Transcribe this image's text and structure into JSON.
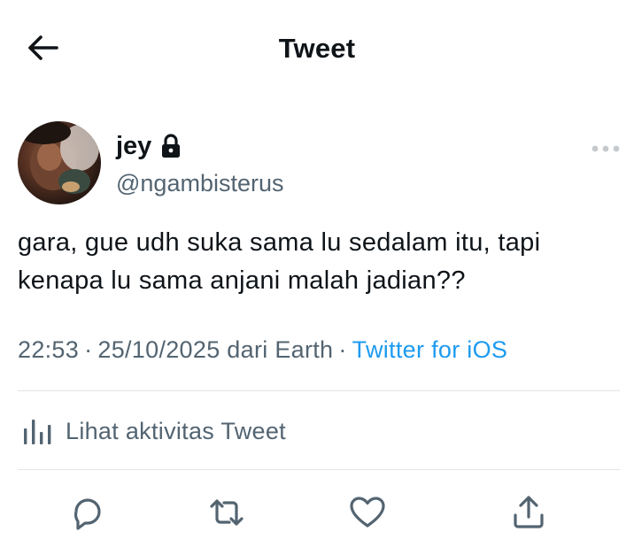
{
  "header": {
    "title": "Tweet",
    "back_icon": "arrow-left-icon"
  },
  "author": {
    "display_name": "jey",
    "handle": "@ngambisterus",
    "protected_icon": "lock-icon"
  },
  "tweet": {
    "text_line_1": "gara, gue udh suka sama lu sedalam itu, tapi",
    "text_line_2": "kenapa lu sama anjani malah jadian??",
    "time": "22:53",
    "date": "25/10/2025 dari Earth",
    "separator": "·",
    "source": "Twitter for iOS"
  },
  "activity": {
    "label": "Lihat aktivitas Tweet",
    "icon": "analytics-icon"
  },
  "actions": {
    "reply_icon": "reply-icon",
    "retweet_icon": "retweet-icon",
    "like_icon": "heart-icon",
    "share_icon": "share-icon"
  },
  "colors": {
    "text": "#0f1419",
    "secondary": "#536471",
    "link": "#1d9bf0",
    "divider": "#e1e5e8"
  }
}
